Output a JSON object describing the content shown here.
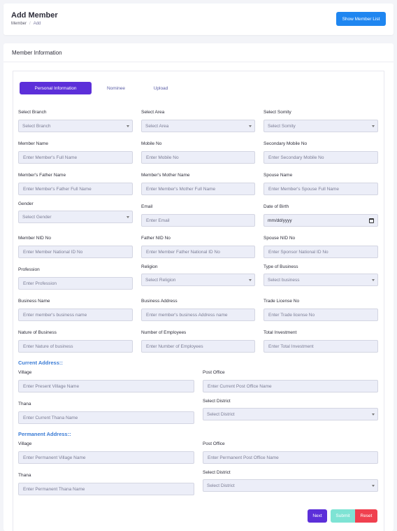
{
  "header": {
    "title": "Add Member",
    "breadcrumb": [
      "Member",
      "Add"
    ],
    "show_list_button": "Show Member List"
  },
  "form": {
    "section_title": "Member Information",
    "tabs": [
      {
        "label": "Personal Information",
        "active": true
      },
      {
        "label": "Nominee",
        "active": false
      },
      {
        "label": "Upload",
        "active": false
      }
    ],
    "fields": {
      "branch": {
        "label": "Select Branch",
        "value": "Select Branch"
      },
      "area": {
        "label": "Select Area",
        "value": "Select Area"
      },
      "somity": {
        "label": "Select Somity",
        "value": "Select Somity"
      },
      "member_name": {
        "label": "Member Name",
        "placeholder": "Enter Member's Full Name"
      },
      "mobile": {
        "label": "Mobile No",
        "placeholder": "Enter Mobile No"
      },
      "secondary_mobile": {
        "label": "Secondary Mobile No",
        "placeholder": "Enter Secondary Mobile No"
      },
      "father_name": {
        "label": "Member's Father Name",
        "placeholder": "Enter Member's Father Full Name"
      },
      "mother_name": {
        "label": "Member's Mother Name",
        "placeholder": "Enter Member's Mother Full Name"
      },
      "spouse_name": {
        "label": "Spouse Name",
        "placeholder": "Enter Member's Spouse Full Name"
      },
      "gender": {
        "label": "Gender",
        "value": "Select Gender"
      },
      "email": {
        "label": "Email",
        "placeholder": "Enter Email"
      },
      "dob": {
        "label": "Date of Birth",
        "value": "mm/dd/yyyy"
      },
      "member_nid": {
        "label": "Member NID No",
        "placeholder": "Enter Member National ID No"
      },
      "father_nid": {
        "label": "Father NID No",
        "placeholder": "Enter Member Father National ID No"
      },
      "spouse_nid": {
        "label": "Spouse NID No",
        "placeholder": "Enter Sponsor National ID No"
      },
      "profession": {
        "label": "Profession",
        "placeholder": "Enter Profession"
      },
      "religion": {
        "label": "Religion",
        "value": "Select Religion"
      },
      "business_type": {
        "label": "Type of Business",
        "value": "Select business"
      },
      "business_name": {
        "label": "Business Name",
        "placeholder": "Enter member's business name"
      },
      "business_address": {
        "label": "Business Address",
        "placeholder": "Enter member's business Address name"
      },
      "trade_license": {
        "label": "Trade License No",
        "placeholder": "Enter Trade license No"
      },
      "nature_business": {
        "label": "Nature of Business",
        "placeholder": "Enter Nature of business"
      },
      "employees": {
        "label": "Number of Employees",
        "placeholder": "Enter Number of Employees"
      },
      "total_investment": {
        "label": "Total Investment",
        "placeholder": "Enter Total Investment"
      }
    },
    "current_address": {
      "heading": "Current Address::",
      "village": {
        "label": "Village",
        "placeholder": "Enter Present Village Name"
      },
      "post_office": {
        "label": "Post Office",
        "placeholder": "Enter Current Post Office Name"
      },
      "thana": {
        "label": "Thana",
        "placeholder": "Enter Current Thana Name"
      },
      "district": {
        "label": "Select District",
        "value": "Select District"
      }
    },
    "permanent_address": {
      "heading": "Permanent Address::",
      "village": {
        "label": "Village",
        "placeholder": "Enter Permanent Village Name"
      },
      "post_office": {
        "label": "Post Office",
        "placeholder": "Enter Permanent Post Office Name"
      },
      "thana": {
        "label": "Thana",
        "placeholder": "Enter Permanent Thana Name"
      },
      "district": {
        "label": "Select District",
        "value": "Select District"
      }
    },
    "buttons": {
      "next": "Next",
      "submit": "Submit",
      "reset": "Reset"
    }
  },
  "colors": {
    "primary": "#5c2fd9",
    "blue_button": "#1f86f0",
    "section_heading": "#3a7bd5",
    "submit": "#7ee3d4",
    "reset": "#f0404f",
    "input_bg": "#eceef8"
  }
}
